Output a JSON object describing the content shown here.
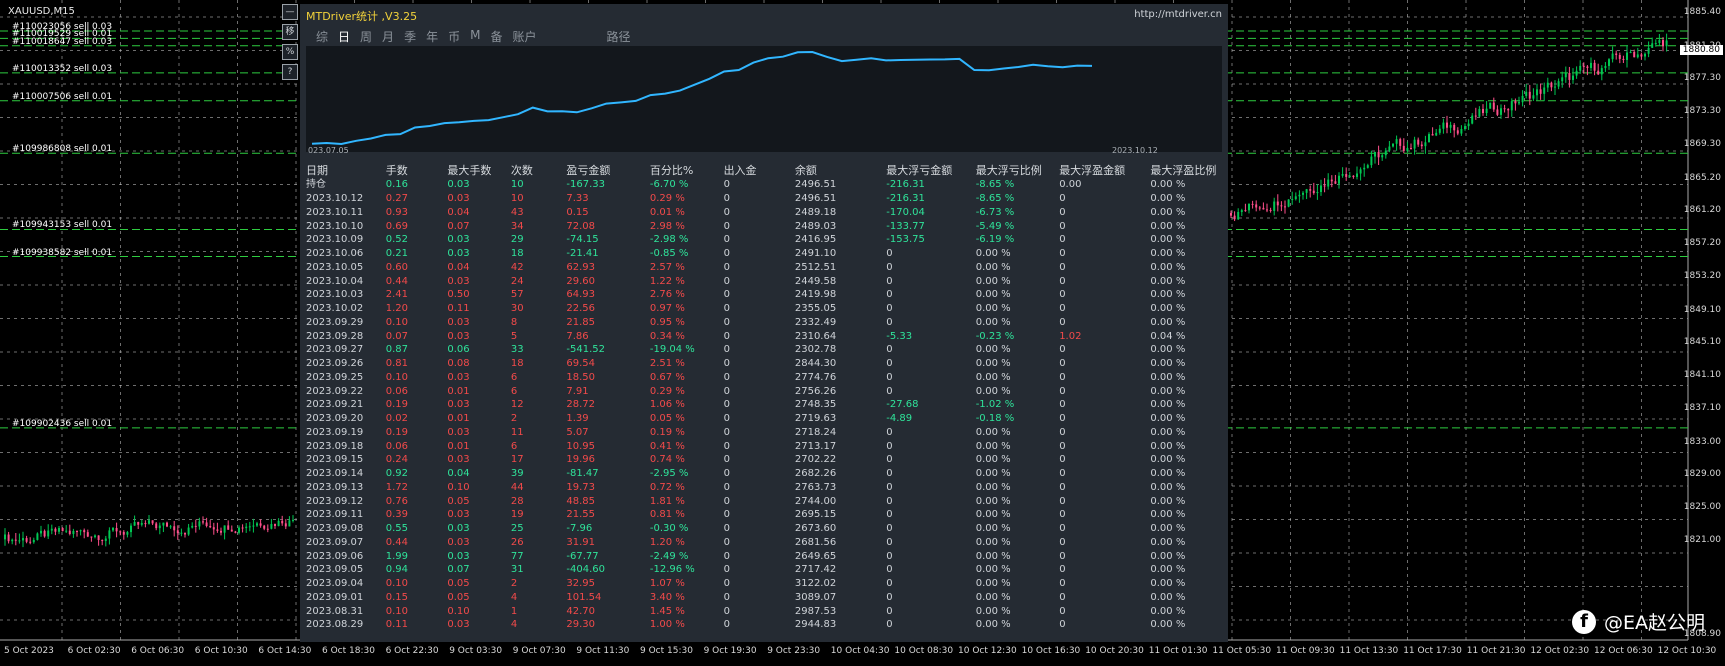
{
  "symbol": "XAUUSD,M15",
  "current_price": "1880.80",
  "orders": [
    {
      "label": "#110023056 sell 0.03",
      "price": 1883.2
    },
    {
      "label": "#110019529 sell 0.01",
      "price": 1882.3
    },
    {
      "label": "#110018647 sell 0.03",
      "price": 1881.4
    },
    {
      "label": "#110013352 sell 0.03",
      "price": 1878.1
    },
    {
      "label": "#110007506 sell 0.01",
      "price": 1874.7
    },
    {
      "label": "#109986808 sell 0.01",
      "price": 1868.3
    },
    {
      "label": "#109943153 sell 0.01",
      "price": 1859.0
    },
    {
      "label": "#109938582 sell 0.01",
      "price": 1855.7
    },
    {
      "label": "#109902436 sell 0.01",
      "price": 1834.8
    }
  ],
  "price_axis": [
    "1885.40",
    "1881.20",
    "1877.30",
    "1873.30",
    "1869.30",
    "1865.20",
    "1861.20",
    "1857.20",
    "1853.20",
    "1849.10",
    "1845.10",
    "1841.10",
    "1837.10",
    "1833.00",
    "1829.00",
    "1825.00",
    "1821.00",
    "1808.90"
  ],
  "time_axis": [
    "5 Oct 2023",
    "6 Oct 02:30",
    "6 Oct 06:30",
    "6 Oct 10:30",
    "6 Oct 14:30",
    "6 Oct 18:30",
    "6 Oct 22:30",
    "9 Oct 03:30",
    "9 Oct 07:30",
    "9 Oct 11:30",
    "9 Oct 15:30",
    "9 Oct 19:30",
    "9 Oct 23:30",
    "10 Oct 04:30",
    "10 Oct 08:30",
    "10 Oct 12:30",
    "10 Oct 16:30",
    "10 Oct 20:30",
    "11 Oct 01:30",
    "11 Oct 05:30",
    "11 Oct 09:30",
    "11 Oct 13:30",
    "11 Oct 17:30",
    "11 Oct 21:30",
    "12 Oct 02:30",
    "12 Oct 06:30",
    "12 Oct 10:30"
  ],
  "side_buttons": [
    "—",
    "移",
    "%",
    "?"
  ],
  "panel": {
    "title": "MTDriver统计 ,V3.25",
    "url": "http://mtdriver.cn",
    "tabs": [
      "综",
      "日",
      "周",
      "月",
      "季",
      "年",
      "币",
      "M",
      "备",
      "账户"
    ],
    "active_tab": "日",
    "path_tab": "路径",
    "equity_start": "023.07.05",
    "equity_end": "2023.10.12",
    "equity_curve": [
      2500,
      2505,
      2498,
      2520,
      2535,
      2560,
      2565,
      2610,
      2620,
      2640,
      2645,
      2655,
      2660,
      2680,
      2700,
      2745,
      2719,
      2720,
      2713,
      2740,
      2772,
      2780,
      2790,
      2830,
      2840,
      2860,
      2900,
      2940,
      2990,
      3000,
      3050,
      3080,
      3090,
      3120,
      3122,
      3089,
      3060,
      3070,
      3080,
      3065,
      3068,
      3070,
      3071,
      3072,
      3075,
      3000,
      2998,
      3010,
      3020,
      3035,
      3025,
      3018,
      3030,
      3028
    ]
  },
  "columns": [
    "日期",
    "手数",
    "最大手数",
    "次数",
    "盈亏金额",
    "百分比%",
    "出入金",
    "余额",
    "最大浮亏金额",
    "最大浮亏比例",
    "最大浮盈金额",
    "最大浮盈比例"
  ],
  "rows": [
    [
      "持仓",
      "0.16",
      "0.03",
      "10",
      "-167.33",
      "-6.70 %",
      "0",
      "2496.51",
      "-216.31",
      "-8.65 %",
      "0.00",
      "0.00 %",
      "g"
    ],
    [
      "2023.10.12",
      "0.27",
      "0.03",
      "10",
      "7.33",
      "0.29 %",
      "0",
      "2496.51",
      "-216.31",
      "-8.65 %",
      "0",
      "0.00 %",
      "r"
    ],
    [
      "2023.10.11",
      "0.93",
      "0.04",
      "43",
      "0.15",
      "0.01 %",
      "0",
      "2489.18",
      "-170.04",
      "-6.73 %",
      "0",
      "0.00 %",
      "r"
    ],
    [
      "2023.10.10",
      "0.69",
      "0.07",
      "34",
      "72.08",
      "2.98 %",
      "0",
      "2489.03",
      "-133.77",
      "-5.49 %",
      "0",
      "0.00 %",
      "r"
    ],
    [
      "2023.10.09",
      "0.52",
      "0.03",
      "29",
      "-74.15",
      "-2.98 %",
      "0",
      "2416.95",
      "-153.75",
      "-6.19 %",
      "0",
      "0.00 %",
      "g"
    ],
    [
      "2023.10.06",
      "0.21",
      "0.03",
      "18",
      "-21.41",
      "-0.85 %",
      "0",
      "2491.10",
      "0",
      "0.00 %",
      "0",
      "0.00 %",
      "g"
    ],
    [
      "2023.10.05",
      "0.60",
      "0.04",
      "42",
      "62.93",
      "2.57 %",
      "0",
      "2512.51",
      "0",
      "0.00 %",
      "0",
      "0.00 %",
      "r"
    ],
    [
      "2023.10.04",
      "0.44",
      "0.03",
      "24",
      "29.60",
      "1.22 %",
      "0",
      "2449.58",
      "0",
      "0.00 %",
      "0",
      "0.00 %",
      "r"
    ],
    [
      "2023.10.03",
      "2.41",
      "0.50",
      "57",
      "64.93",
      "2.76 %",
      "0",
      "2419.98",
      "0",
      "0.00 %",
      "0",
      "0.00 %",
      "r"
    ],
    [
      "2023.10.02",
      "1.20",
      "0.11",
      "30",
      "22.56",
      "0.97 %",
      "0",
      "2355.05",
      "0",
      "0.00 %",
      "0",
      "0.00 %",
      "r"
    ],
    [
      "2023.09.29",
      "0.10",
      "0.03",
      "8",
      "21.85",
      "0.95 %",
      "0",
      "2332.49",
      "0",
      "0.00 %",
      "0",
      "0.00 %",
      "r"
    ],
    [
      "2023.09.28",
      "0.07",
      "0.03",
      "5",
      "7.86",
      "0.34 %",
      "0",
      "2310.64",
      "-5.33",
      "-0.23 %",
      "1.02",
      "0.04 %",
      "rr"
    ],
    [
      "2023.09.27",
      "0.87",
      "0.06",
      "33",
      "-541.52",
      "-19.04 %",
      "0",
      "2302.78",
      "0",
      "0.00 %",
      "0",
      "0.00 %",
      "g"
    ],
    [
      "2023.09.26",
      "0.81",
      "0.08",
      "18",
      "69.54",
      "2.51 %",
      "0",
      "2844.30",
      "0",
      "0.00 %",
      "0",
      "0.00 %",
      "r"
    ],
    [
      "2023.09.25",
      "0.10",
      "0.03",
      "6",
      "18.50",
      "0.67 %",
      "0",
      "2774.76",
      "0",
      "0.00 %",
      "0",
      "0.00 %",
      "r"
    ],
    [
      "2023.09.22",
      "0.06",
      "0.01",
      "6",
      "7.91",
      "0.29 %",
      "0",
      "2756.26",
      "0",
      "0.00 %",
      "0",
      "0.00 %",
      "r"
    ],
    [
      "2023.09.21",
      "0.19",
      "0.03",
      "12",
      "28.72",
      "1.06 %",
      "0",
      "2748.35",
      "-27.68",
      "-1.02 %",
      "0",
      "0.00 %",
      "r"
    ],
    [
      "2023.09.20",
      "0.02",
      "0.01",
      "2",
      "1.39",
      "0.05 %",
      "0",
      "2719.63",
      "-4.89",
      "-0.18 %",
      "0",
      "0.00 %",
      "r"
    ],
    [
      "2023.09.19",
      "0.19",
      "0.03",
      "11",
      "5.07",
      "0.19 %",
      "0",
      "2718.24",
      "0",
      "0.00 %",
      "0",
      "0.00 %",
      "r"
    ],
    [
      "2023.09.18",
      "0.06",
      "0.01",
      "6",
      "10.95",
      "0.41 %",
      "0",
      "2713.17",
      "0",
      "0.00 %",
      "0",
      "0.00 %",
      "r"
    ],
    [
      "2023.09.15",
      "0.24",
      "0.03",
      "17",
      "19.96",
      "0.74 %",
      "0",
      "2702.22",
      "0",
      "0.00 %",
      "0",
      "0.00 %",
      "r"
    ],
    [
      "2023.09.14",
      "0.92",
      "0.04",
      "39",
      "-81.47",
      "-2.95 %",
      "0",
      "2682.26",
      "0",
      "0.00 %",
      "0",
      "0.00 %",
      "g"
    ],
    [
      "2023.09.13",
      "1.72",
      "0.10",
      "44",
      "19.73",
      "0.72 %",
      "0",
      "2763.73",
      "0",
      "0.00 %",
      "0",
      "0.00 %",
      "r"
    ],
    [
      "2023.09.12",
      "0.76",
      "0.05",
      "28",
      "48.85",
      "1.81 %",
      "0",
      "2744.00",
      "0",
      "0.00 %",
      "0",
      "0.00 %",
      "r"
    ],
    [
      "2023.09.11",
      "0.39",
      "0.03",
      "19",
      "21.55",
      "0.81 %",
      "0",
      "2695.15",
      "0",
      "0.00 %",
      "0",
      "0.00 %",
      "r"
    ],
    [
      "2023.09.08",
      "0.55",
      "0.03",
      "25",
      "-7.96",
      "-0.30 %",
      "0",
      "2673.60",
      "0",
      "0.00 %",
      "0",
      "0.00 %",
      "g"
    ],
    [
      "2023.09.07",
      "0.44",
      "0.03",
      "26",
      "31.91",
      "1.20 %",
      "0",
      "2681.56",
      "0",
      "0.00 %",
      "0",
      "0.00 %",
      "r"
    ],
    [
      "2023.09.06",
      "1.99",
      "0.03",
      "77",
      "-67.77",
      "-2.49 %",
      "0",
      "2649.65",
      "0",
      "0.00 %",
      "0",
      "0.00 %",
      "g"
    ],
    [
      "2023.09.05",
      "0.94",
      "0.07",
      "31",
      "-404.60",
      "-12.96 %",
      "0",
      "2717.42",
      "0",
      "0.00 %",
      "0",
      "0.00 %",
      "g"
    ],
    [
      "2023.09.04",
      "0.10",
      "0.05",
      "2",
      "32.95",
      "1.07 %",
      "0",
      "3122.02",
      "0",
      "0.00 %",
      "0",
      "0.00 %",
      "r"
    ],
    [
      "2023.09.01",
      "0.15",
      "0.05",
      "4",
      "101.54",
      "3.40 %",
      "0",
      "3089.07",
      "0",
      "0.00 %",
      "0",
      "0.00 %",
      "r"
    ],
    [
      "2023.08.31",
      "0.10",
      "0.10",
      "1",
      "42.70",
      "1.45 %",
      "0",
      "2987.53",
      "0",
      "0.00 %",
      "0",
      "0.00 %",
      "r"
    ],
    [
      "2023.08.29",
      "0.11",
      "0.03",
      "4",
      "29.30",
      "1.00 %",
      "0",
      "2944.83",
      "0",
      "0.00 %",
      "0",
      "0.00 %",
      "r"
    ]
  ],
  "watermark": "@EA赵公明",
  "colors": {
    "up": "#2fe39a",
    "down": "#f24a4a",
    "candle_up": "#00c853",
    "candle_down": "#ff4f8b",
    "grid": "#c8c8c8",
    "order_line": "#2ecc40",
    "title": "#f2d23a",
    "equity": "#31b6ff"
  }
}
